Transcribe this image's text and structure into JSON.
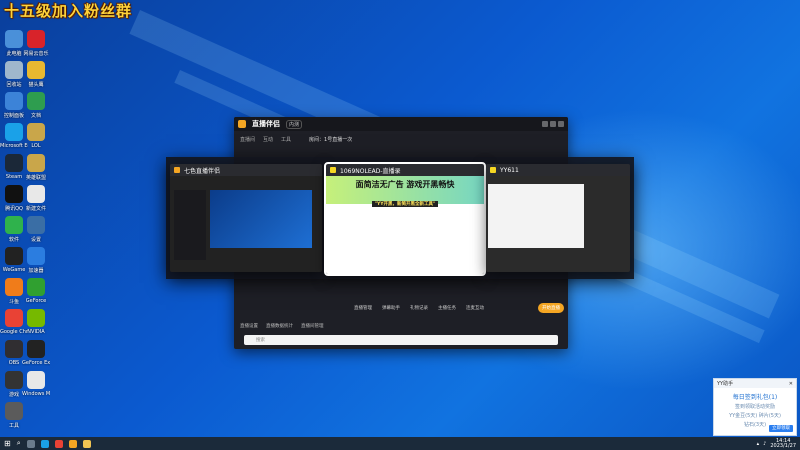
{
  "overlay": {
    "banner": "十五级加入粉丝群"
  },
  "desktop": {
    "icons_col1": [
      {
        "label": "此电脑",
        "icon": "computer-icon",
        "color": "#4a90d9"
      },
      {
        "label": "回收站",
        "icon": "recycle-bin-icon",
        "color": "#9fb7cc"
      },
      {
        "label": "控制面板",
        "icon": "control-panel-icon",
        "color": "#3c83d8"
      },
      {
        "label": "Microsoft Edge",
        "icon": "edge-icon",
        "color": "#1aa1e8"
      },
      {
        "label": "Steam",
        "icon": "steam-icon",
        "color": "#1b2838"
      },
      {
        "label": "腾讯QQ",
        "icon": "qq-icon",
        "color": "#111111"
      },
      {
        "label": "软件",
        "icon": "app-icon",
        "color": "#2fb24c"
      },
      {
        "label": "WeGame",
        "icon": "wegame-icon",
        "color": "#222222"
      },
      {
        "label": "斗鱼",
        "icon": "douyu-icon",
        "color": "#f07c1a"
      },
      {
        "label": "Google Chrome",
        "icon": "chrome-icon",
        "color": "#e94235"
      },
      {
        "label": "OBS",
        "icon": "obs-icon",
        "color": "#302e31"
      },
      {
        "label": "游戏",
        "icon": "game-icon",
        "color": "#333333"
      },
      {
        "label": "工具",
        "icon": "tool-icon",
        "color": "#5b5b5b"
      }
    ],
    "icons_col2": [
      {
        "label": "网易云音乐",
        "icon": "netease-music-icon",
        "color": "#d8232a"
      },
      {
        "label": "猫头鹰",
        "icon": "owl-icon",
        "color": "#e8b830"
      },
      {
        "label": "文档",
        "icon": "document-icon",
        "color": "#2e9d4f"
      },
      {
        "label": "LOL",
        "icon": "lol-icon",
        "color": "#c9a64a"
      },
      {
        "label": "英雄联盟",
        "icon": "league-icon",
        "color": "#c9a64a"
      },
      {
        "label": "新建文件",
        "icon": "file-icon",
        "color": "#e8e8e8"
      },
      {
        "label": "设置",
        "icon": "settings-icon",
        "color": "#3a6ea5"
      },
      {
        "label": "加速器",
        "icon": "accelerator-icon",
        "color": "#2b7de0"
      },
      {
        "label": "GeForce",
        "icon": "geforce-icon",
        "color": "#30a030"
      },
      {
        "label": "NVIDIA",
        "icon": "nvidia-icon",
        "color": "#76b900"
      },
      {
        "label": "GeForce Experience",
        "icon": "nvidia-experience-icon",
        "color": "#222222"
      },
      {
        "label": "Windows Media",
        "icon": "media-icon",
        "color": "#e8e8e8"
      }
    ]
  },
  "windows": {
    "main_app": {
      "title": "直播伴侣",
      "badge": "内测",
      "room": "房间：1号直播一次",
      "toolbar": [
        "直播间",
        "互动",
        "工具"
      ],
      "bottom_tools": [
        "直播管理",
        "弹幕助手",
        "礼物记录",
        "主播任务",
        "连麦互动",
        "更多"
      ],
      "start_button": "开始直播",
      "footer_items": [
        "直播设置",
        "直播数据统计",
        "直播间管理"
      ],
      "search_placeholder": "搜索"
    },
    "thumb1": {
      "title": "七色直播伴侣"
    },
    "thumb2": {
      "title": "1069NOLEAD-直播录",
      "ad_line1": "面简洁无广告  游戏开黑畅快",
      "ad_line2": "\"YY开黑，新简开黑全新工具\""
    },
    "thumb3": {
      "title": "YY611"
    }
  },
  "taskbar": {
    "time": "14:14",
    "date": "2023/1/27"
  },
  "notification": {
    "header": "YY助手",
    "title": "每日签到礼包(1)",
    "line1": "签到领取活动奖励",
    "line2": "YY金豆(5天) 碎片(5天)",
    "line3": "钻石(3天)",
    "button": "立即领取"
  },
  "colors": {
    "accent": "#f5a623",
    "wallpaper": "#0b5ad0",
    "taskbar": "#1b2a3a"
  }
}
